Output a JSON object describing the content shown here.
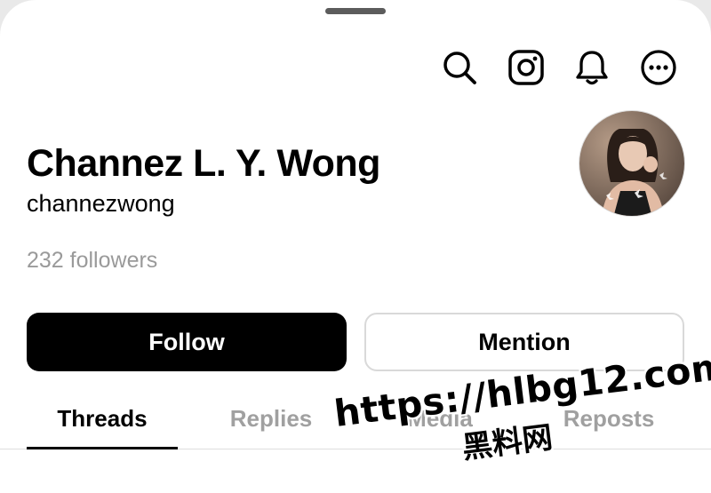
{
  "header": {
    "icons": [
      "search-icon",
      "instagram-icon",
      "notifications-bell-icon",
      "more-options-icon"
    ]
  },
  "profile": {
    "display_name": "Channez L. Y. Wong",
    "username": "channezwong",
    "followers_text": "232 followers"
  },
  "actions": {
    "follow_label": "Follow",
    "mention_label": "Mention"
  },
  "tabs": [
    {
      "label": "Threads",
      "active": true
    },
    {
      "label": "Replies",
      "active": false
    },
    {
      "label": "Media",
      "active": false
    },
    {
      "label": "Reposts",
      "active": false
    }
  ],
  "watermark": {
    "url": "https://hlbg12.com",
    "text": "黑料网"
  },
  "colors": {
    "primary_button": "#000000",
    "secondary_text": "#9a9a9a",
    "inactive_tab": "#a0a0a0"
  }
}
